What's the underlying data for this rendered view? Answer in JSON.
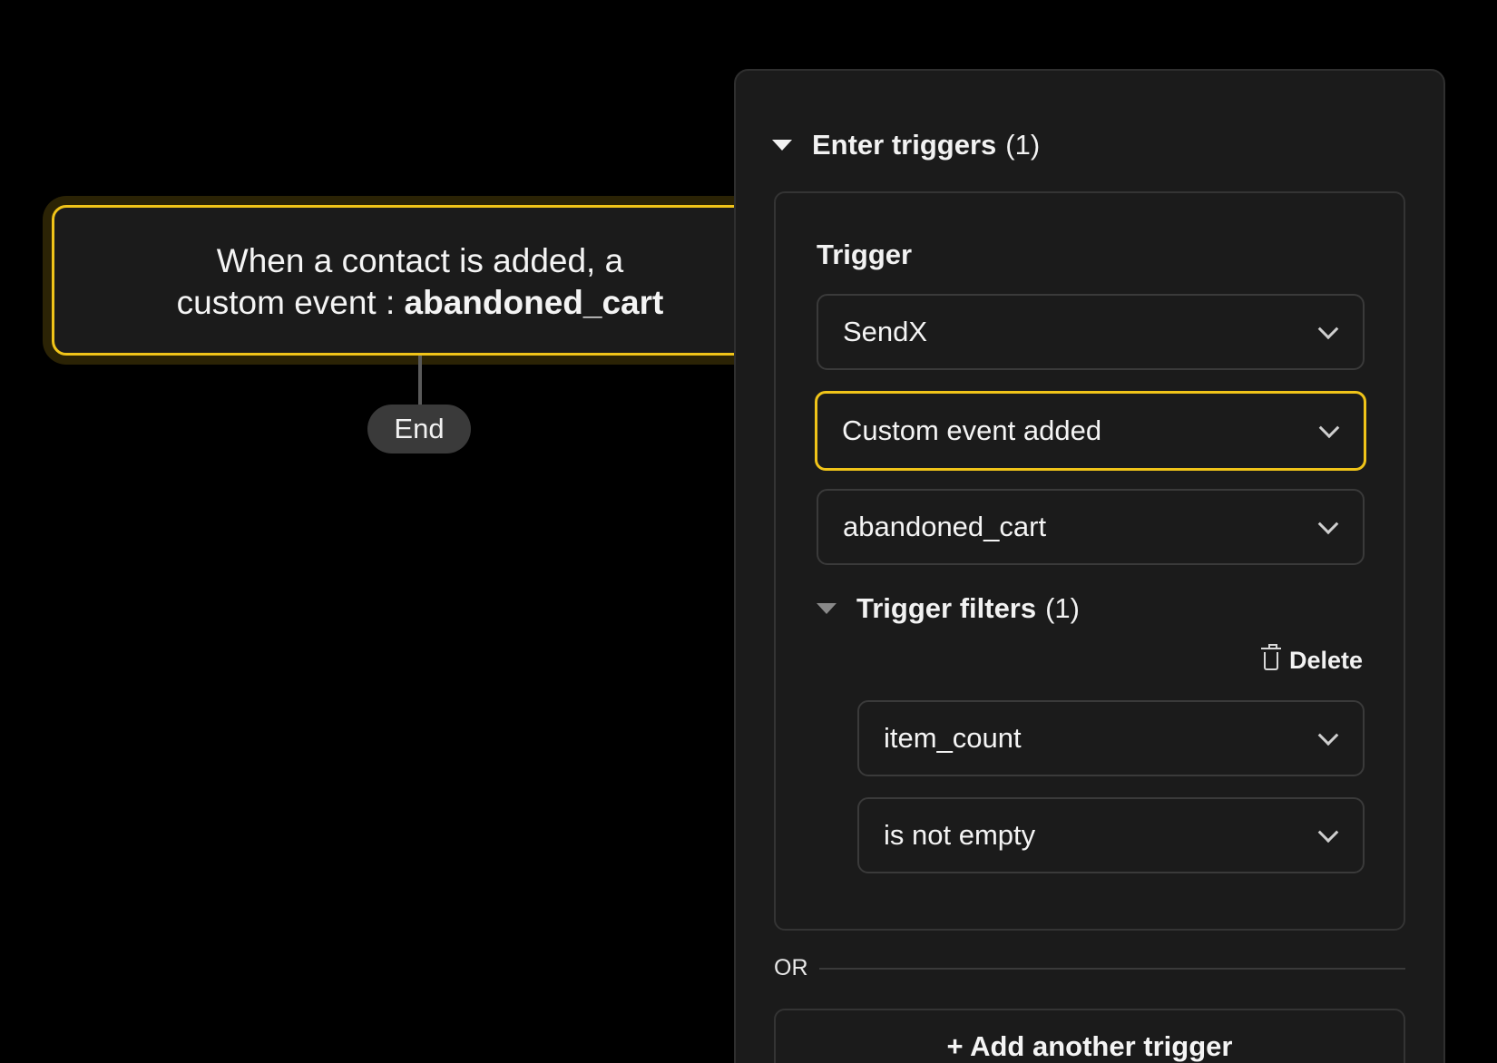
{
  "node": {
    "line1": "When a contact is added, a",
    "line2_prefix": "custom event : ",
    "line2_bold": "abandoned_cart"
  },
  "end_label": "End",
  "panel": {
    "enter_triggers": {
      "label": "Enter triggers",
      "count": "(1)"
    },
    "trigger_label": "Trigger",
    "selects": {
      "app": "SendX",
      "event_type": "Custom event added",
      "event_name": "abandoned_cart"
    },
    "trigger_filters": {
      "label": "Trigger filters",
      "count": "(1)"
    },
    "delete_label": "Delete",
    "filter": {
      "property": "item_count",
      "operator": "is not empty"
    },
    "or_label": "OR",
    "add_trigger_label": "+ Add another trigger"
  },
  "colors": {
    "accent": "#f0c419",
    "panel_bg": "#1b1b1b",
    "canvas_bg": "#000000"
  }
}
